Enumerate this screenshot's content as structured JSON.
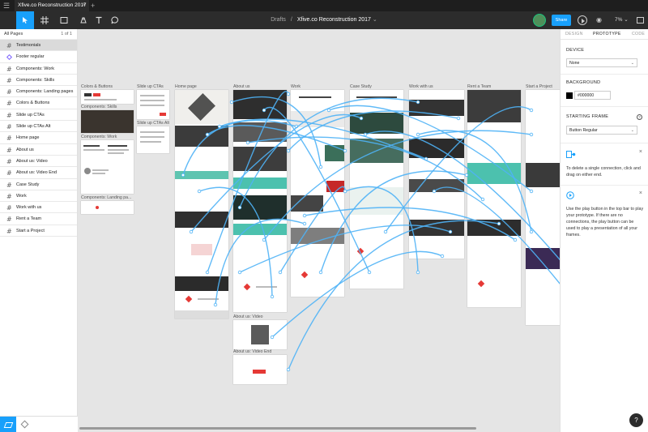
{
  "tab": {
    "title": "Xfive.co Reconstruction 2017",
    "close": "×",
    "add": "+"
  },
  "toolbar": {
    "breadcrumb_folder": "Drafts",
    "breadcrumb_sep": "/",
    "file_name": "Xfive.co Reconstruction 2017",
    "file_menu": "⌄",
    "share_label": "Share",
    "zoom_label": "7%",
    "zoom_chevron": "⌄",
    "tools": [
      "move-tool",
      "frame-tool",
      "shape-tool",
      "pen-tool",
      "text-tool",
      "comment-tool"
    ],
    "accent": "#18a0fb"
  },
  "pages": {
    "label": "All Pages",
    "count": "1 of 1"
  },
  "layers": [
    {
      "name": "Testimonials",
      "kind": "frame",
      "selected": true
    },
    {
      "name": "Footer regular",
      "kind": "component",
      "selected": false
    },
    {
      "name": "Components: Work",
      "kind": "frame"
    },
    {
      "name": "Components: Skills",
      "kind": "frame"
    },
    {
      "name": "Components: Landing pages",
      "kind": "frame"
    },
    {
      "name": "Colors & Buttons",
      "kind": "frame"
    },
    {
      "name": "Slide up CTAs",
      "kind": "frame"
    },
    {
      "name": "Slide up CTAs Alt",
      "kind": "frame"
    },
    {
      "name": "Home page",
      "kind": "frame"
    },
    {
      "name": "About us",
      "kind": "frame"
    },
    {
      "name": "About us: Video",
      "kind": "frame"
    },
    {
      "name": "About us: Video End",
      "kind": "frame"
    },
    {
      "name": "Case Study",
      "kind": "frame"
    },
    {
      "name": "Work",
      "kind": "frame"
    },
    {
      "name": "Work with us",
      "kind": "frame"
    },
    {
      "name": "Rent a Team",
      "kind": "frame"
    },
    {
      "name": "Start a Project",
      "kind": "frame"
    }
  ],
  "canvas": {
    "frame_labels": {
      "colors": "Colors & Buttons",
      "comp_skills": "Components: Skills",
      "comp_work": "Components: Work",
      "comp_landing": "Components: Landing pa...",
      "slide": "Slide up CTAs",
      "slide_alt": "Slide up CTAs Alt",
      "home": "Home page",
      "about": "About us",
      "about_video": "About us: Video",
      "about_video_end": "About us: Video End",
      "work": "Work",
      "case": "Case Study",
      "workwith": "Work with us",
      "rent": "Rent a Team",
      "start": "Start a Project"
    },
    "connection_color": "#4fb3f6"
  },
  "prototype": {
    "tabs": [
      "DESIGN",
      "PROTOTYPE",
      "CODE"
    ],
    "device_title": "DEVICE",
    "device_value": "None",
    "background_title": "BACKGROUND",
    "background_hex": "#000000",
    "starting_frame_title": "STARTING FRAME",
    "starting_frame_value": "Button Regular",
    "help_glyph": "?",
    "hint1": "To delete a single connection, click and drag on either end.",
    "hint2": "Use the play button in the top bar to play your prototype. If there are no connections, the play button can be used to play a presentation of all your frames.",
    "close_glyph": "×",
    "chevron_glyph": "⌄"
  },
  "help": {
    "label": "?"
  }
}
